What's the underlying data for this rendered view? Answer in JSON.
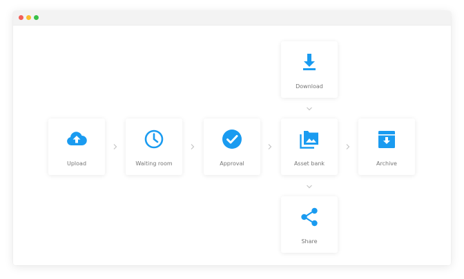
{
  "colors": {
    "accent": "#1a9bf0",
    "dot_red": "#f25f58",
    "dot_yellow": "#fbbe2e",
    "dot_green": "#38c149",
    "chevron": "#c4c4c4"
  },
  "workflow": {
    "steps": [
      {
        "label": "Upload",
        "icon": "cloud-upload-icon"
      },
      {
        "label": "Waiting room",
        "icon": "clock-icon"
      },
      {
        "label": "Approval",
        "icon": "check-circle-icon"
      },
      {
        "label": "Asset bank",
        "icon": "photo-library-icon"
      },
      {
        "label": "Archive",
        "icon": "archive-box-icon"
      }
    ],
    "download": {
      "label": "Download",
      "icon": "download-icon"
    },
    "share": {
      "label": "Share",
      "icon": "share-icon"
    }
  }
}
